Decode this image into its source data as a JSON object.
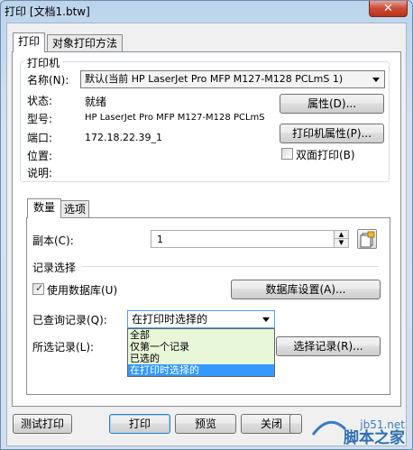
{
  "window": {
    "title": "打印 [文档1.btw]",
    "close_glyph": "✕"
  },
  "tabs": {
    "print": "打印",
    "object_print": "对象打印方法"
  },
  "printer": {
    "group_title": "打印机",
    "name_label": "名称(N):",
    "name_value": "默认(当前 HP LaserJet Pro MFP M127-M128 PCLmS 1)",
    "status_label": "状态:",
    "status_value": "就绪",
    "model_label": "型号:",
    "model_value": "HP LaserJet Pro MFP M127-M128 PCLmS",
    "port_label": "端口:",
    "port_value": "172.18.22.39_1",
    "location_label": "位置:",
    "comment_label": "说明:",
    "properties_button": "属性(D)...",
    "printer_properties_button": "打印机属性(P)...",
    "duplex_label": "双面打印(B)",
    "duplex_checked": false
  },
  "subtabs": {
    "quantity": "数量",
    "options": "选项"
  },
  "quantity": {
    "copies_label": "副本(C):",
    "copies_value": "1",
    "record_section": "记录选择",
    "use_database_label": "使用数据库(U)",
    "use_database_checked": true,
    "database_settings_button": "数据库设置(A)...",
    "queried_records_label": "已查询记录(Q):",
    "queried_records_value": "在打印时选择的",
    "dropdown_options": [
      "全部",
      "仅第一个记录",
      "已选的",
      "在打印时选择的"
    ],
    "dropdown_selected_index": 3,
    "selected_records_label": "所选记录(L):",
    "select_records_button": "选择记录(R)..."
  },
  "footer": {
    "test_print_button": "测试打印",
    "print_button": "打印",
    "preview_button": "预览",
    "close_button": "关闭"
  },
  "watermark": {
    "site": "jb51.net",
    "brand": "脚本之家"
  },
  "colors": {
    "dropdown_bg": "#e7f7d8",
    "selection": "#3399ff",
    "close_red": "#c94a34"
  }
}
